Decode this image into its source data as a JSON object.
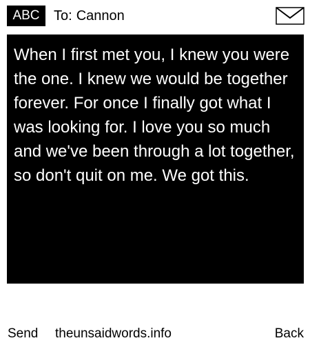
{
  "header": {
    "input_mode": "ABC",
    "recipient_prefix": "To:",
    "recipient_name": "Cannon",
    "icon": "envelope-icon"
  },
  "message": {
    "body": "When I first met you, I knew you were the one. I knew we would be together forever. For once I finally got what I was looking for. I love you so much and we've been through a lot together, so don't quit on me. We got this."
  },
  "footer": {
    "left_softkey": "Send",
    "site": "theunsaidwords.info",
    "right_softkey": "Back"
  },
  "colors": {
    "background": "#ffffff",
    "message_background": "#000000",
    "message_text": "#ffffff",
    "text": "#000000"
  }
}
